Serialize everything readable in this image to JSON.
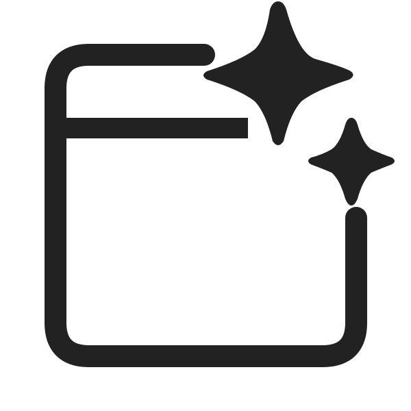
{
  "icon": {
    "name": "window-sparkle-icon",
    "color": "#222222",
    "background": "#ffffff"
  }
}
